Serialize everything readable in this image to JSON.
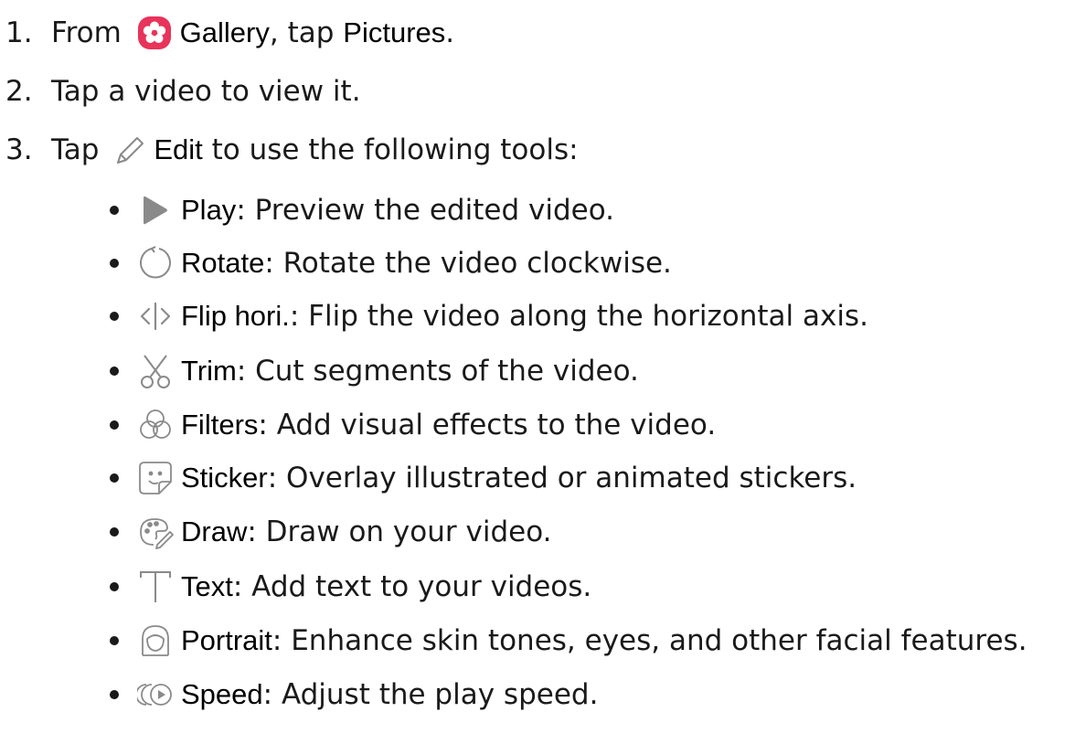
{
  "steps": [
    {
      "num": "1.",
      "pre": "From ",
      "icon": "gallery-app-icon",
      "term": "Gallery",
      "mid": ", tap ",
      "term2": "Pictures",
      "post": "."
    },
    {
      "num": "2.",
      "text": "Tap a video to view it."
    },
    {
      "num": "3.",
      "pre": "Tap ",
      "icon": "edit-pencil-icon",
      "term": "Edit",
      "post": " to use the following tools:"
    }
  ],
  "tools": [
    {
      "icon": "play-icon",
      "term": "Play",
      "desc": ": Preview the edited video."
    },
    {
      "icon": "rotate-icon",
      "term": "Rotate",
      "desc": ": Rotate the video clockwise."
    },
    {
      "icon": "flip-horizontal-icon",
      "term": "Flip hori.",
      "desc": ": Flip the video along the horizontal axis."
    },
    {
      "icon": "scissors-icon",
      "term": "Trim",
      "desc": ": Cut segments of the video."
    },
    {
      "icon": "filters-icon",
      "term": "Filters",
      "desc": ": Add visual effects to the video."
    },
    {
      "icon": "sticker-icon",
      "term": "Sticker",
      "desc": ": Overlay illustrated or animated stickers."
    },
    {
      "icon": "draw-palette-icon",
      "term": "Draw",
      "desc": ": Draw on your video."
    },
    {
      "icon": "text-icon",
      "term": "Text",
      "desc": ": Add text to your videos."
    },
    {
      "icon": "portrait-icon",
      "term": "Portrait",
      "desc": ": Enhance skin tones, eyes, and other facial features."
    },
    {
      "icon": "speed-icon",
      "term": "Speed",
      "desc": ": Adjust the play speed."
    }
  ],
  "colors": {
    "gallery_icon": "#e8335a",
    "icon_gray": "#8a8a8a"
  }
}
